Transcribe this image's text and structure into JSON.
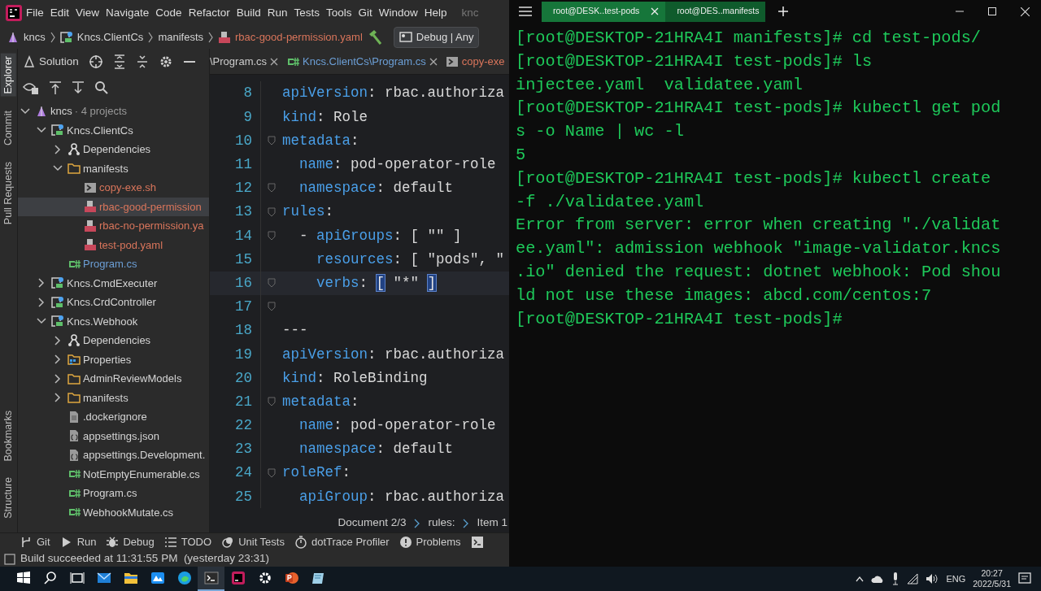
{
  "ide": {
    "menu": [
      "File",
      "Edit",
      "View",
      "Navigate",
      "Code",
      "Refactor",
      "Build",
      "Run",
      "Tests",
      "Tools",
      "Git",
      "Window",
      "Help"
    ],
    "title": "knc",
    "breadcrumb": [
      {
        "kind": "solution",
        "label": "kncs"
      },
      {
        "kind": "project",
        "label": "Kncs.ClientCs"
      },
      {
        "kind": "plain",
        "label": "manifests"
      },
      {
        "kind": "yaml",
        "label": "rbac-good-permission.yaml"
      }
    ],
    "run_config": "Debug | Any",
    "side_tabs": {
      "top": [
        {
          "label": "Explorer",
          "selected": true
        },
        {
          "label": "Commit",
          "selected": false
        },
        {
          "label": "Pull Requests",
          "selected": false
        }
      ],
      "bottom": [
        {
          "label": "Bookmarks",
          "selected": false
        },
        {
          "label": "Structure",
          "selected": false
        }
      ]
    },
    "solution_title": "Solution",
    "tree": [
      {
        "kind": "solution",
        "label": "kncs",
        "note": "· 4 projects",
        "expanded": true,
        "selected": false,
        "children": [
          {
            "kind": "project",
            "label": "Kncs.ClientCs",
            "expanded": true,
            "selected": false,
            "children": [
              {
                "kind": "dependencies",
                "label": "Dependencies",
                "expanded": false,
                "selected": false
              },
              {
                "kind": "folder",
                "label": "manifests",
                "expanded": true,
                "selected": false,
                "children": [
                  {
                    "kind": "shell",
                    "label": "copy-exe.sh",
                    "color": "#d9755b",
                    "selected": false
                  },
                  {
                    "kind": "yaml",
                    "label": "rbac-good-permission",
                    "color": "#d9755b",
                    "selected": true
                  },
                  {
                    "kind": "yaml",
                    "label": "rbac-no-permission.ya",
                    "color": "#d9755b",
                    "selected": false
                  },
                  {
                    "kind": "yaml",
                    "label": "test-pod.yaml",
                    "color": "#d9755b",
                    "selected": false
                  }
                ]
              },
              {
                "kind": "csharp",
                "label": "Program.cs",
                "color": "#6c9fd6",
                "selected": false
              }
            ]
          },
          {
            "kind": "project",
            "label": "Kncs.CmdExecuter",
            "expanded": false,
            "selected": false
          },
          {
            "kind": "project",
            "label": "Kncs.CrdController",
            "expanded": false,
            "selected": false
          },
          {
            "kind": "project",
            "label": "Kncs.Webhook",
            "expanded": true,
            "selected": false,
            "children": [
              {
                "kind": "dependencies",
                "label": "Dependencies",
                "expanded": false,
                "selected": false
              },
              {
                "kind": "properties",
                "label": "Properties",
                "expanded": false,
                "selected": false
              },
              {
                "kind": "folder",
                "label": "AdminReviewModels",
                "expanded": false,
                "selected": false
              },
              {
                "kind": "folder",
                "label": "manifests",
                "expanded": false,
                "selected": false
              },
              {
                "kind": "file",
                "label": ".dockerignore",
                "selected": false
              },
              {
                "kind": "json",
                "label": "appsettings.json",
                "selected": false
              },
              {
                "kind": "json",
                "label": "appsettings.Development.",
                "selected": false
              },
              {
                "kind": "csharp",
                "label": "NotEmptyEnumerable.cs",
                "selected": false
              },
              {
                "kind": "csharp",
                "label": "Program.cs",
                "selected": false
              },
              {
                "kind": "csharp",
                "label": "WebhookMutate.cs",
                "selected": false
              }
            ]
          }
        ]
      }
    ],
    "editor_tabs": [
      {
        "kind": "plain",
        "label": "\\Program.cs",
        "closable": true
      },
      {
        "kind": "csharp",
        "label": "Kncs.ClientCs\\Program.cs",
        "closable": true
      },
      {
        "kind": "shell",
        "label": "copy-exe",
        "closable": false
      }
    ],
    "code": [
      {
        "num": "8",
        "current": false,
        "fold": false,
        "tokens": [
          {
            "kind": "key",
            "text": "apiVersion"
          },
          {
            "kind": "text",
            "text": ": rbac.authoriza"
          }
        ]
      },
      {
        "num": "9",
        "current": false,
        "fold": false,
        "tokens": [
          {
            "kind": "key",
            "text": "kind"
          },
          {
            "kind": "text",
            "text": ": Role"
          }
        ]
      },
      {
        "num": "10",
        "current": false,
        "fold": true,
        "tokens": [
          {
            "kind": "key",
            "text": "metadata"
          },
          {
            "kind": "text",
            "text": ":"
          }
        ]
      },
      {
        "num": "11",
        "current": false,
        "fold": false,
        "tokens": [
          {
            "kind": "key",
            "text": "  name"
          },
          {
            "kind": "text",
            "text": ": pod-operator-role"
          }
        ]
      },
      {
        "num": "12",
        "current": false,
        "fold": true,
        "tokens": [
          {
            "kind": "key",
            "text": "  namespace"
          },
          {
            "kind": "text",
            "text": ": default"
          }
        ]
      },
      {
        "num": "13",
        "current": false,
        "fold": true,
        "tokens": [
          {
            "kind": "key",
            "text": "rules"
          },
          {
            "kind": "text",
            "text": ":"
          }
        ]
      },
      {
        "num": "14",
        "current": false,
        "fold": true,
        "tokens": [
          {
            "kind": "text",
            "text": "  - "
          },
          {
            "kind": "key",
            "text": "apiGroups"
          },
          {
            "kind": "text",
            "text": ": [ \"\" ]"
          }
        ]
      },
      {
        "num": "15",
        "current": false,
        "fold": false,
        "tokens": [
          {
            "kind": "key",
            "text": "    resources"
          },
          {
            "kind": "text",
            "text": ": [ \"pods\", \""
          }
        ]
      },
      {
        "num": "16",
        "current": true,
        "fold": true,
        "tokens": [
          {
            "kind": "key",
            "text": "    verbs"
          },
          {
            "kind": "text",
            "text": ": "
          },
          {
            "kind": "match",
            "text": "["
          },
          {
            "kind": "text",
            "text": " \"*\" "
          },
          {
            "kind": "match",
            "text": "]"
          }
        ]
      },
      {
        "num": "17",
        "current": false,
        "fold": true
      },
      {
        "num": "18",
        "current": false,
        "fold": false,
        "tokens": [
          {
            "kind": "text",
            "text": "---"
          }
        ]
      },
      {
        "num": "19",
        "current": false,
        "fold": false,
        "tokens": [
          {
            "kind": "key",
            "text": "apiVersion"
          },
          {
            "kind": "text",
            "text": ": rbac.authoriza"
          }
        ]
      },
      {
        "num": "20",
        "current": false,
        "fold": false,
        "tokens": [
          {
            "kind": "key",
            "text": "kind"
          },
          {
            "kind": "text",
            "text": ": RoleBinding"
          }
        ]
      },
      {
        "num": "21",
        "current": false,
        "fold": true,
        "tokens": [
          {
            "kind": "key",
            "text": "metadata"
          },
          {
            "kind": "text",
            "text": ":"
          }
        ]
      },
      {
        "num": "22",
        "current": false,
        "fold": false,
        "tokens": [
          {
            "kind": "key",
            "text": "  name"
          },
          {
            "kind": "text",
            "text": ": pod-operator-role"
          }
        ]
      },
      {
        "num": "23",
        "current": false,
        "fold": false,
        "tokens": [
          {
            "kind": "key",
            "text": "  namespace"
          },
          {
            "kind": "text",
            "text": ": default"
          }
        ]
      },
      {
        "num": "24",
        "current": false,
        "fold": true,
        "tokens": [
          {
            "kind": "key",
            "text": "roleRef"
          },
          {
            "kind": "text",
            "text": ":"
          }
        ]
      },
      {
        "num": "25",
        "current": false,
        "fold": false,
        "tokens": [
          {
            "kind": "key",
            "text": "  apiGroup"
          },
          {
            "kind": "text",
            "text": ": rbac.authoriza"
          }
        ]
      }
    ],
    "editor_path": [
      "Document 2/3",
      "rules:",
      "Item 1"
    ],
    "tool_windows": [
      {
        "kind": "git",
        "label": "Git"
      },
      {
        "kind": "run",
        "label": "Run"
      },
      {
        "kind": "debug",
        "label": "Debug"
      },
      {
        "kind": "todo",
        "label": "TODO"
      },
      {
        "kind": "tests",
        "label": "Unit Tests"
      },
      {
        "kind": "profiler",
        "label": "dotTrace Profiler"
      },
      {
        "kind": "problems",
        "label": "Problems"
      },
      {
        "kind": "terminal"
      }
    ],
    "status": "Build succeeded at 11:31:55 PM  (yesterday 23:31)"
  },
  "terminal": {
    "tabs": [
      {
        "label": "root@DESK..test-pods",
        "selected": true
      },
      {
        "label": "root@DES..manifests",
        "selected": false
      }
    ],
    "lines": [
      "[root@DESKTOP-21HRA4I manifests]# cd test-pods/",
      "[root@DESKTOP-21HRA4I test-pods]# ls",
      "injectee.yaml  validatee.yaml",
      "[root@DESKTOP-21HRA4I test-pods]# kubectl get pod",
      "s -o Name | wc -l",
      "5",
      "[root@DESKTOP-21HRA4I test-pods]# kubectl create",
      "-f ./validatee.yaml",
      "Error from server: error when creating \"./validat",
      "ee.yaml\": admission webhook \"image-validator.kncs",
      ".io\" denied the request: dotnet webhook: Pod shou",
      "ld not use these images: abcd.com/centos:7",
      "[root@DESKTOP-21HRA4I test-pods]#"
    ]
  },
  "taskbar": {
    "apps": [
      {
        "kind": "mail",
        "active": false
      },
      {
        "kind": "files",
        "active": false
      },
      {
        "kind": "app",
        "active": false
      },
      {
        "kind": "edge",
        "active": false
      },
      {
        "kind": "terminal",
        "active": true
      },
      {
        "kind": "rider",
        "active": false
      },
      {
        "kind": "settings",
        "active": false
      },
      {
        "kind": "powerpoint",
        "active": false
      },
      {
        "kind": "notepad",
        "active": false
      }
    ],
    "language": "ENG",
    "time": "20:27",
    "date": "2022/5/31"
  }
}
